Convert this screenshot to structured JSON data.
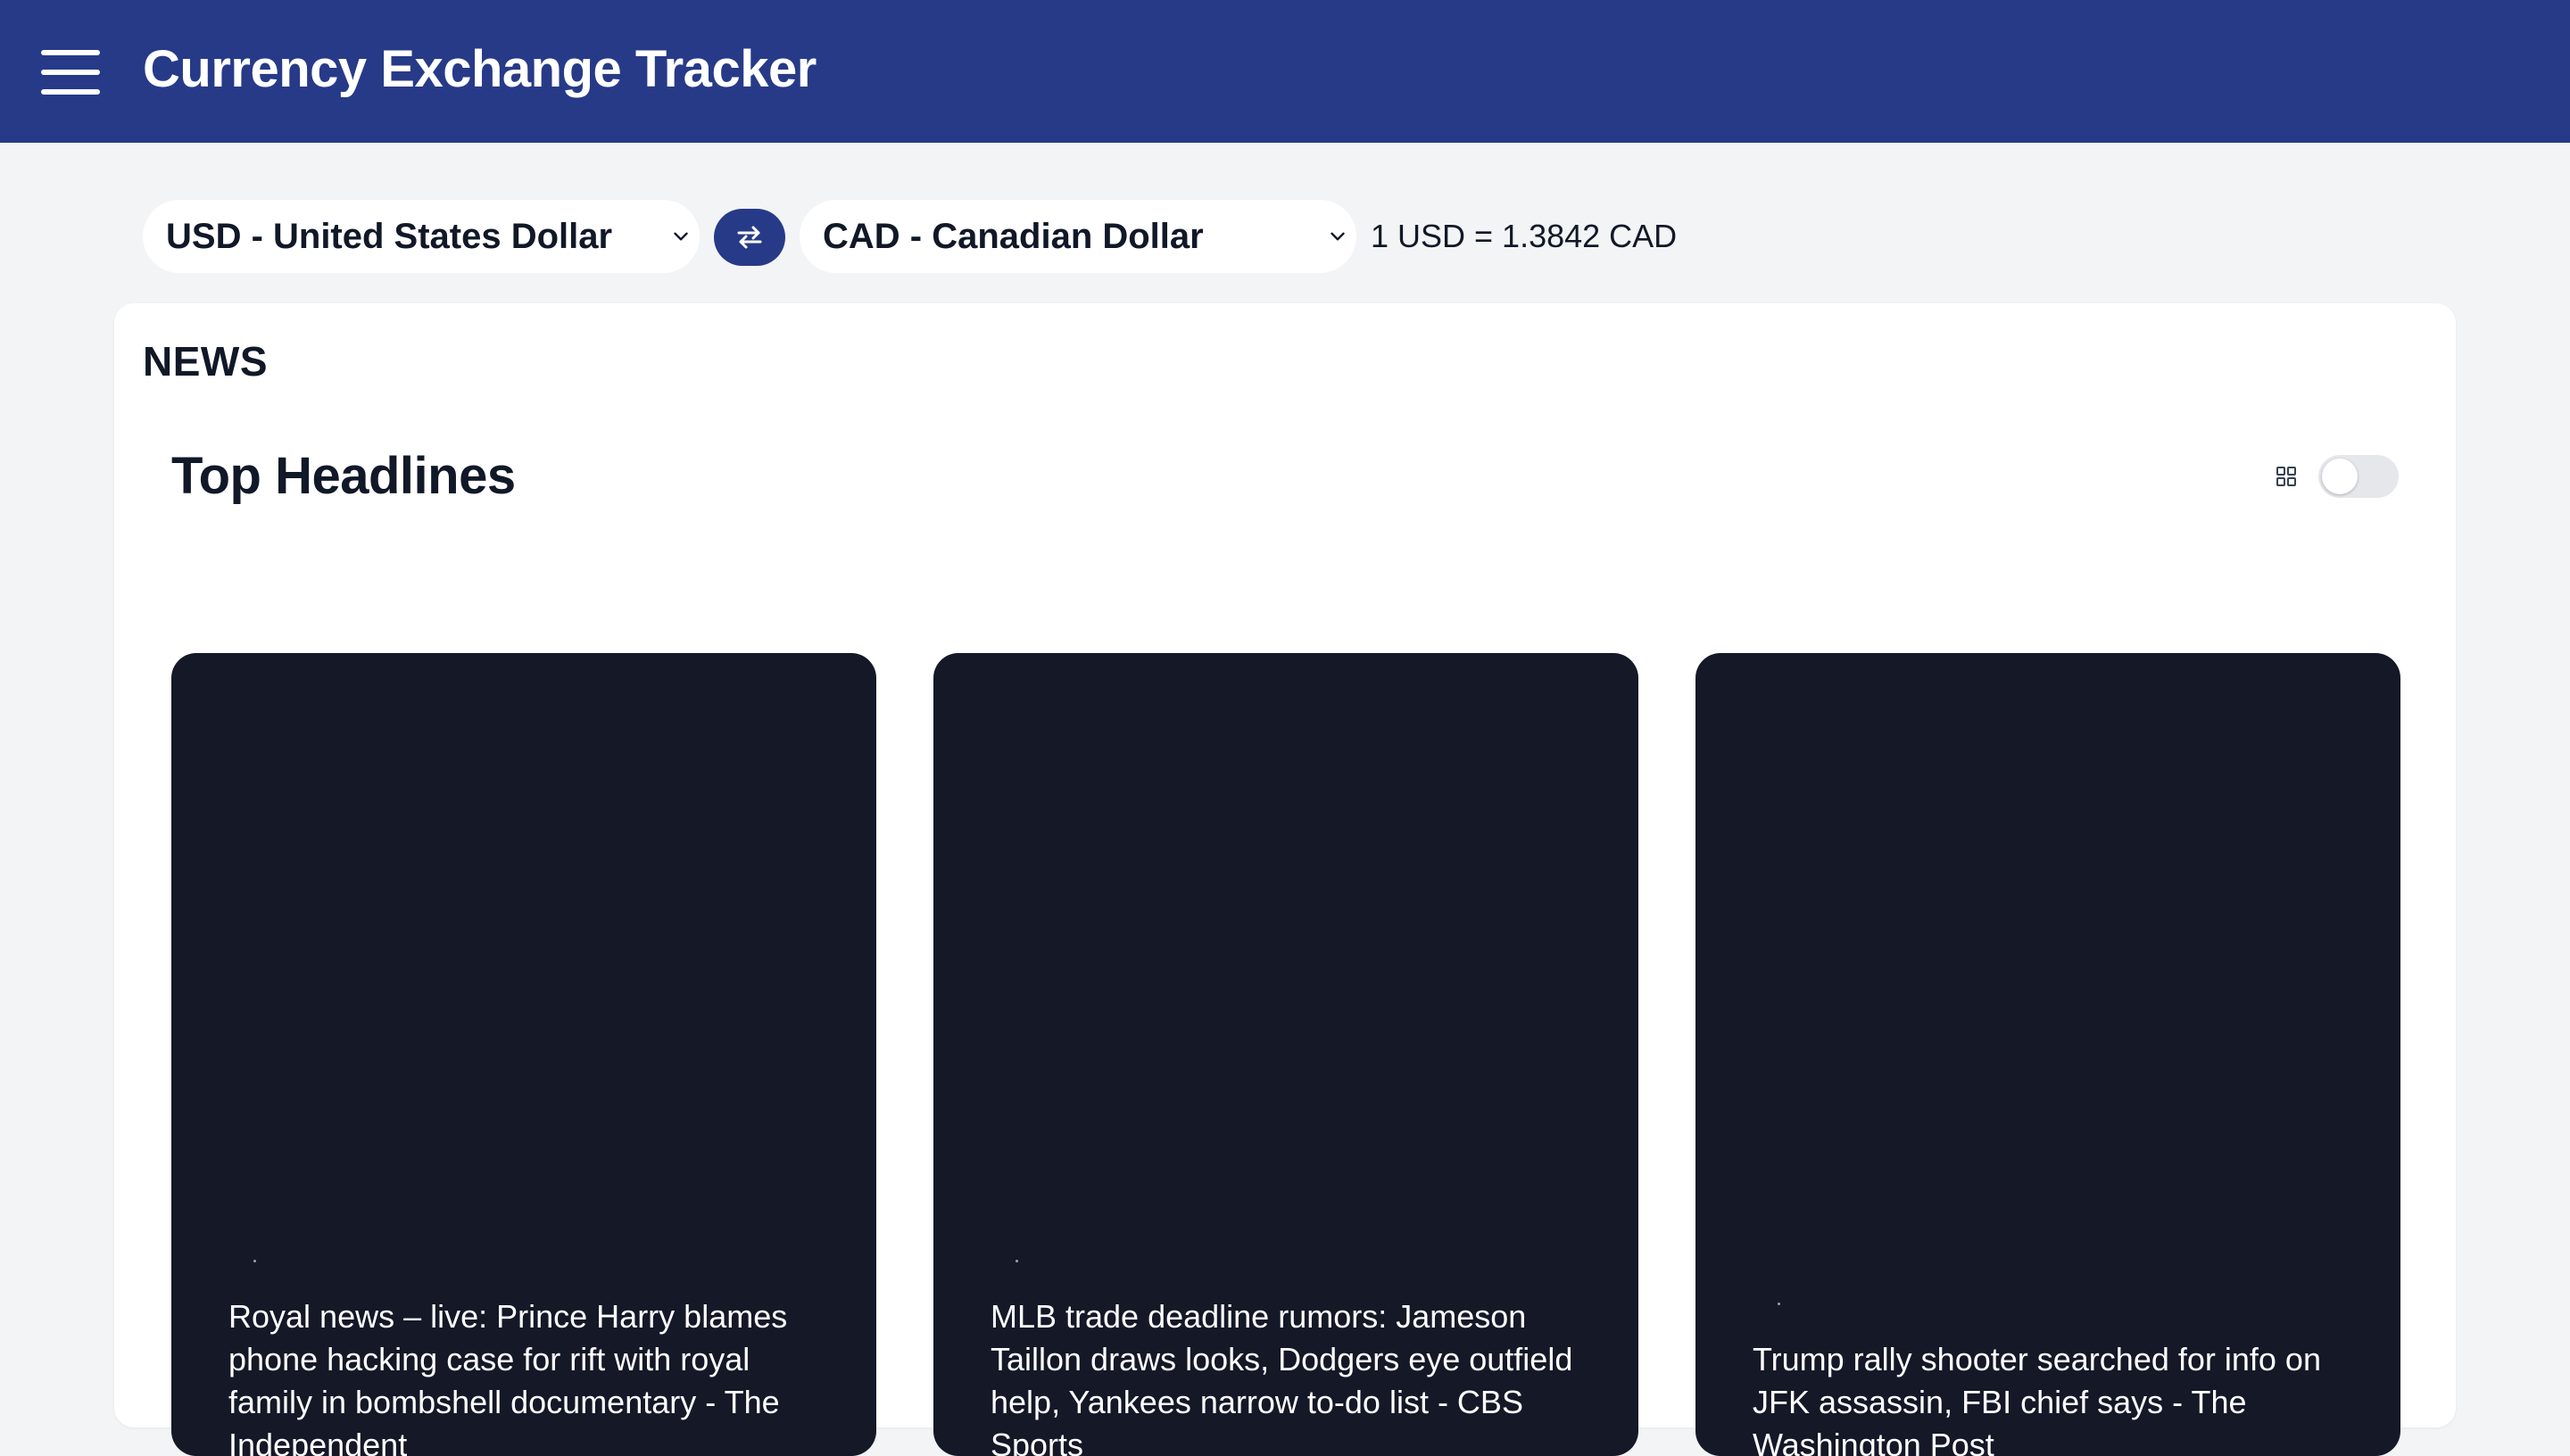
{
  "header": {
    "title": "Currency Exchange Tracker"
  },
  "converter": {
    "from_currency": "USD - United States Dollar",
    "to_currency": "CAD - Canadian Dollar",
    "rate_text": "1 USD = 1.3842 CAD"
  },
  "news": {
    "section_label": "NEWS",
    "heading": "Top Headlines",
    "grid_view_enabled": false,
    "articles": [
      {
        "headline": "Royal news – live: Prince Harry blames phone hacking case for rift with royal family in bombshell documentary - The Independent"
      },
      {
        "headline": "MLB trade deadline rumors: Jameson Taillon draws looks, Dodgers eye outfield help, Yankees narrow to-do list - CBS Sports"
      },
      {
        "headline": "Trump rally shooter searched for info on JFK assassin, FBI chief says - The Washington Post"
      }
    ]
  },
  "colors": {
    "header_bg": "#273a88",
    "page_bg": "#f3f4f6",
    "card_bg": "#141827"
  }
}
